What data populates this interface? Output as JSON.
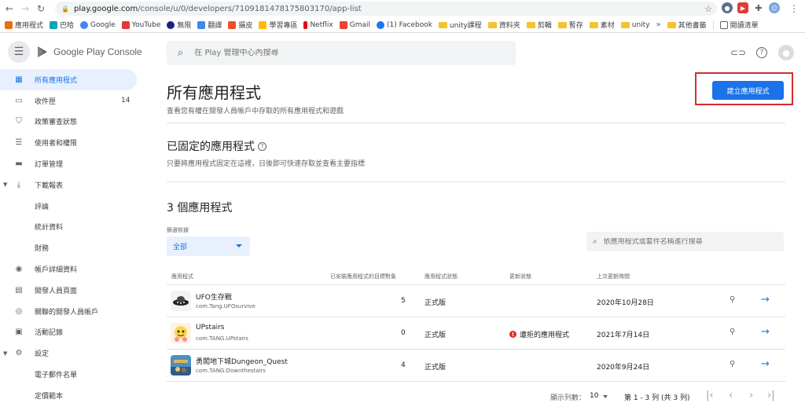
{
  "browser": {
    "url_host": "play.google.com",
    "url_path": "/console/u/0/developers/7109181478175803170/app-list",
    "bookmarks": [
      "應用程式",
      "巴哈",
      "Google",
      "YouTube",
      "無限",
      "翻譯",
      "摄皮",
      "學習專區",
      "Netflix",
      "Gmail",
      "(1) Facebook",
      "unity課程",
      "資料夾",
      "剪輯",
      "暫存",
      "素材",
      "unity"
    ],
    "other_bookmarks": "其他書籤",
    "reading_list": "閱讀清單"
  },
  "header": {
    "brand": "Google Play Console",
    "search_placeholder": "在 Play 管理中心內搜尋"
  },
  "sidebar": {
    "items": [
      {
        "label": "所有應用程式",
        "icon": "grid-icon",
        "glyph": "▦"
      },
      {
        "label": "收件匣",
        "icon": "inbox-icon",
        "glyph": "▭",
        "badge": "14"
      },
      {
        "label": "政策審查狀態",
        "icon": "shield-icon",
        "glyph": "⛉"
      },
      {
        "label": "使用者和權限",
        "icon": "people-icon",
        "glyph": "☰"
      },
      {
        "label": "訂單管理",
        "icon": "card-icon",
        "glyph": "▬"
      },
      {
        "label": "下載報表",
        "icon": "download-icon",
        "glyph": "⤓"
      },
      {
        "label": "評論"
      },
      {
        "label": "統計資料"
      },
      {
        "label": "財務"
      },
      {
        "label": "帳戶詳細資料",
        "icon": "account-icon",
        "glyph": "◉"
      },
      {
        "label": "開發人員頁面",
        "icon": "web-icon",
        "glyph": "▤"
      },
      {
        "label": "關聯的開發人員帳戶",
        "icon": "link-accounts-icon",
        "glyph": "◎"
      },
      {
        "label": "活動記錄",
        "icon": "log-icon",
        "glyph": "▣"
      },
      {
        "label": "設定",
        "icon": "settings-icon",
        "glyph": "⚙"
      },
      {
        "label": "電子郵件名單"
      },
      {
        "label": "定價範本"
      }
    ]
  },
  "main": {
    "title": "所有應用程式",
    "subtitle": "查看您有權在開發人員帳戶中存取的所有應用程式和遊戲",
    "create_button": "建立應用程式",
    "pinned_title": "已固定的應用程式",
    "pinned_help": "?",
    "pinned_sub": "只要將應用程式固定在這裡，日後即可快速存取並查看主要指標",
    "count_title": "3 個應用程式",
    "filter_label": "篩選依據",
    "filter_value": "全部",
    "app_search_placeholder": "依應用程式或套件名稱進行搜尋"
  },
  "table": {
    "headers": [
      "應用程式",
      "已安裝應用程式的目標對象",
      "應用程式狀態",
      "更新狀態",
      "上次更新時間"
    ],
    "rows": [
      {
        "name": "UFO生存戰",
        "package": "com.Tang.UFOsurvive",
        "installs": "5",
        "status": "正式版",
        "update": "",
        "date": "2020年10月28日"
      },
      {
        "name": "UPstairs",
        "package": "com.TANG.UPstairs",
        "installs": "0",
        "status": "正式版",
        "update": "遭拒的應用程式",
        "date": "2021年7月14日"
      },
      {
        "name": "勇闖地下城Dungeon_Quest",
        "package": "com.TANG.Downthestairs",
        "installs": "4",
        "status": "正式版",
        "update": "",
        "date": "2020年9月24日"
      }
    ]
  },
  "pager": {
    "rows_label": "顯示列數：",
    "rows_value": "10",
    "range": "第 1 - 3 列 (共 3 列)"
  },
  "colors": {
    "accent": "#1a73e8",
    "highlight": "#d32f2f",
    "error": "#d93025"
  }
}
